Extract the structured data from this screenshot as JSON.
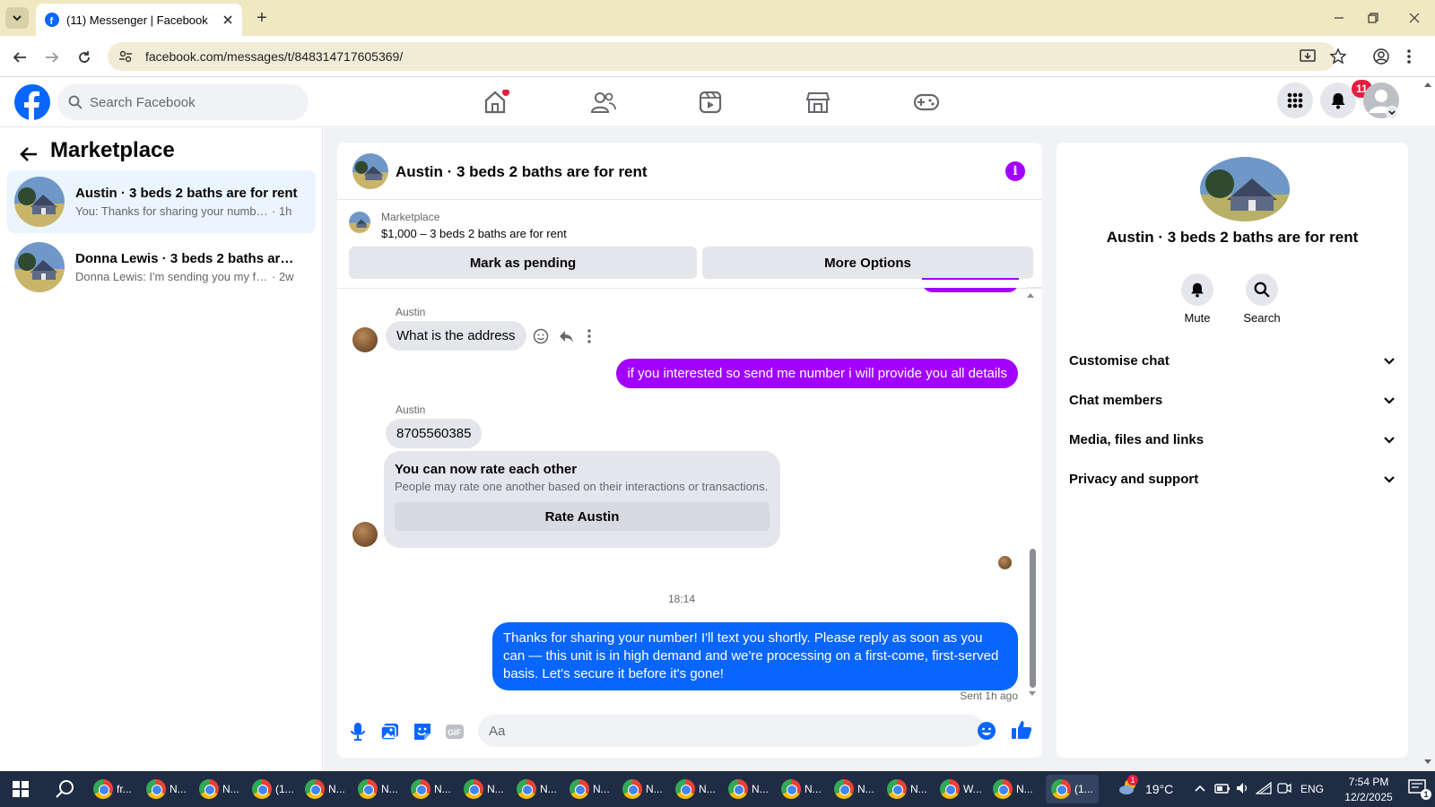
{
  "browser": {
    "tab_title": "(11) Messenger | Facebook",
    "url": "facebook.com/messages/t/848314717605369/"
  },
  "header": {
    "search_placeholder": "Search Facebook",
    "notifications_count": "11",
    "nav_icons": [
      "home-icon",
      "friends-icon",
      "video-icon",
      "marketplace-icon",
      "gaming-icon"
    ]
  },
  "sidebar": {
    "title": "Marketplace",
    "conversations": [
      {
        "title": "Austin · 3 beds 2 baths are for rent",
        "preview": "You: Thanks for sharing your number! ...",
        "time": "· 1h",
        "active": true
      },
      {
        "title": "Donna Lewis · 3 beds 2 baths are f...",
        "preview": "Donna Lewis: I'm sending you my fian...",
        "time": "· 2w",
        "active": false
      }
    ]
  },
  "chat": {
    "title": "Austin · 3 beds 2 baths are for rent",
    "marketplace_label": "Marketplace",
    "listing": "$1,000 – 3 beds 2 baths are for rent",
    "mark_pending": "Mark as pending",
    "more_options": "More Options",
    "messages": {
      "m1_sender": "Austin",
      "m1_text": "What is the address",
      "m2_text": "if you interested so send me number i will provide you all details",
      "m3_sender": "Austin",
      "m3_text": "8705560385",
      "rate_title": "You can now rate each other",
      "rate_sub": "People may rate one another based on their interactions or transactions.",
      "rate_button": "Rate Austin",
      "timestamp": "18:14",
      "m4_text": "Thanks for sharing your number! I'll text you shortly. Please reply as soon as you can — this unit is in high demand and we're processing on a first-come, first-served basis. Let's secure it before it's gone!",
      "status": "Sent 1h ago"
    },
    "composer_placeholder": "Aa"
  },
  "right_panel": {
    "title": "Austin · 3 beds 2 baths are for rent",
    "mute": "Mute",
    "search": "Search",
    "sections": [
      "Customise chat",
      "Chat members",
      "Media, files and links",
      "Privacy and support"
    ]
  },
  "taskbar": {
    "items": [
      "fr...",
      "N...",
      "N...",
      "(1...",
      "N...",
      "N...",
      "N...",
      "N...",
      "N...",
      "N...",
      "N...",
      "N...",
      "N...",
      "N...",
      "N...",
      "N...",
      "W...",
      "N...",
      "(1..."
    ],
    "weather": "19°C",
    "weather_badge": "1",
    "lang": "ENG",
    "time": "7:54 PM",
    "date": "12/2/2025",
    "notif_count": "1"
  },
  "colors": {
    "fb_blue": "#0866ff",
    "purple": "#a200ff",
    "badge_red": "#e41e3f"
  }
}
